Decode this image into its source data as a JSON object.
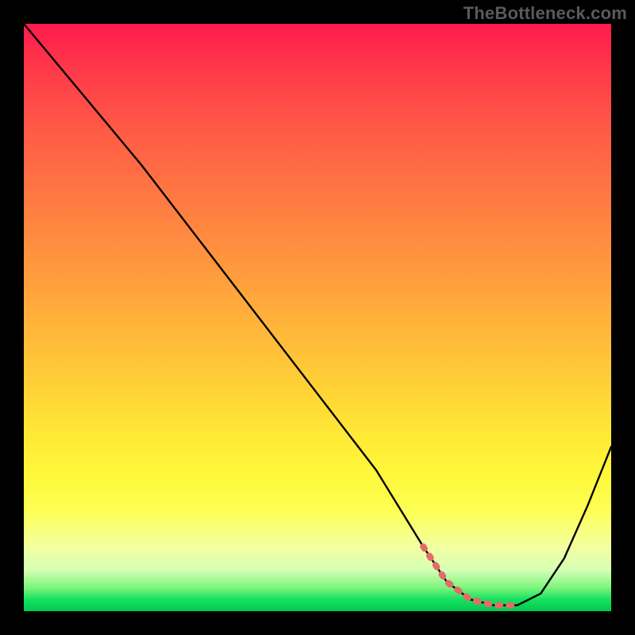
{
  "attribution": "TheBottleneck.com",
  "chart_data": {
    "type": "line",
    "title": "",
    "xlabel": "",
    "ylabel": "",
    "xlim": [
      0,
      100
    ],
    "ylim": [
      0,
      100
    ],
    "series": [
      {
        "name": "curve",
        "x": [
          0,
          10,
          20,
          30,
          40,
          50,
          60,
          68,
          72,
          76,
          80,
          84,
          88,
          92,
          96,
          100
        ],
        "values": [
          100,
          88,
          76,
          63,
          50,
          37,
          24,
          11,
          5,
          2,
          1,
          1,
          3,
          9,
          18,
          28
        ]
      }
    ],
    "highlight_range": {
      "x_start": 68,
      "x_end": 86
    },
    "gradient_colors": {
      "top": "#ff1a4d",
      "mid_upper": "#ff9a3e",
      "mid": "#ffe936",
      "mid_lower": "#d6ffb4",
      "bottom": "#00c94f"
    },
    "curve_color": "#000000",
    "highlight_color": "#e66a6a"
  }
}
